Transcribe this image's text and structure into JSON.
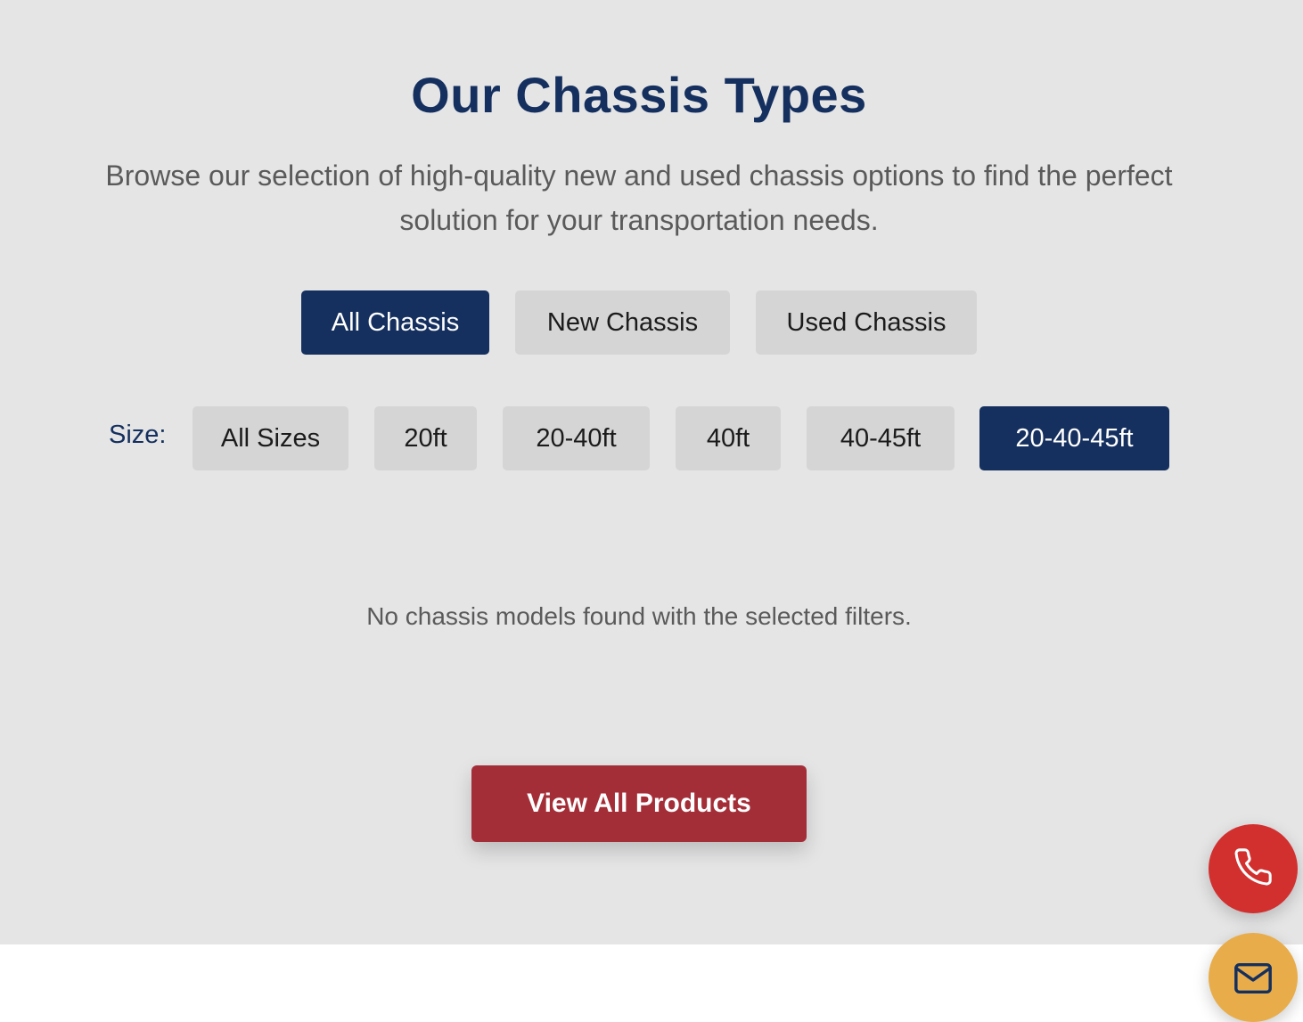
{
  "header": {
    "title": "Our Chassis Types",
    "subtitle": "Browse our selection of high-quality new and used chassis options to find the perfect solution for your transportation needs."
  },
  "type_filters": [
    {
      "label": "All Chassis",
      "active": true
    },
    {
      "label": "New Chassis",
      "active": false
    },
    {
      "label": "Used Chassis",
      "active": false
    }
  ],
  "size_filter": {
    "label": "Size:",
    "options": [
      {
        "label": "All Sizes",
        "active": false
      },
      {
        "label": "20ft",
        "active": false
      },
      {
        "label": "20-40ft",
        "active": false
      },
      {
        "label": "40ft",
        "active": false
      },
      {
        "label": "40-45ft",
        "active": false
      },
      {
        "label": "20-40-45ft",
        "active": true
      }
    ]
  },
  "results": {
    "empty_message": "No chassis models found with the selected filters."
  },
  "cta": {
    "view_all_label": "View All Products"
  },
  "floating_actions": {
    "phone_icon": "phone-icon",
    "mail_icon": "mail-icon"
  },
  "colors": {
    "primary": "#15305e",
    "cta": "#a42e37",
    "phone": "#d2302f",
    "mail": "#e8ad4a",
    "section_bg": "#e5e5e6"
  }
}
